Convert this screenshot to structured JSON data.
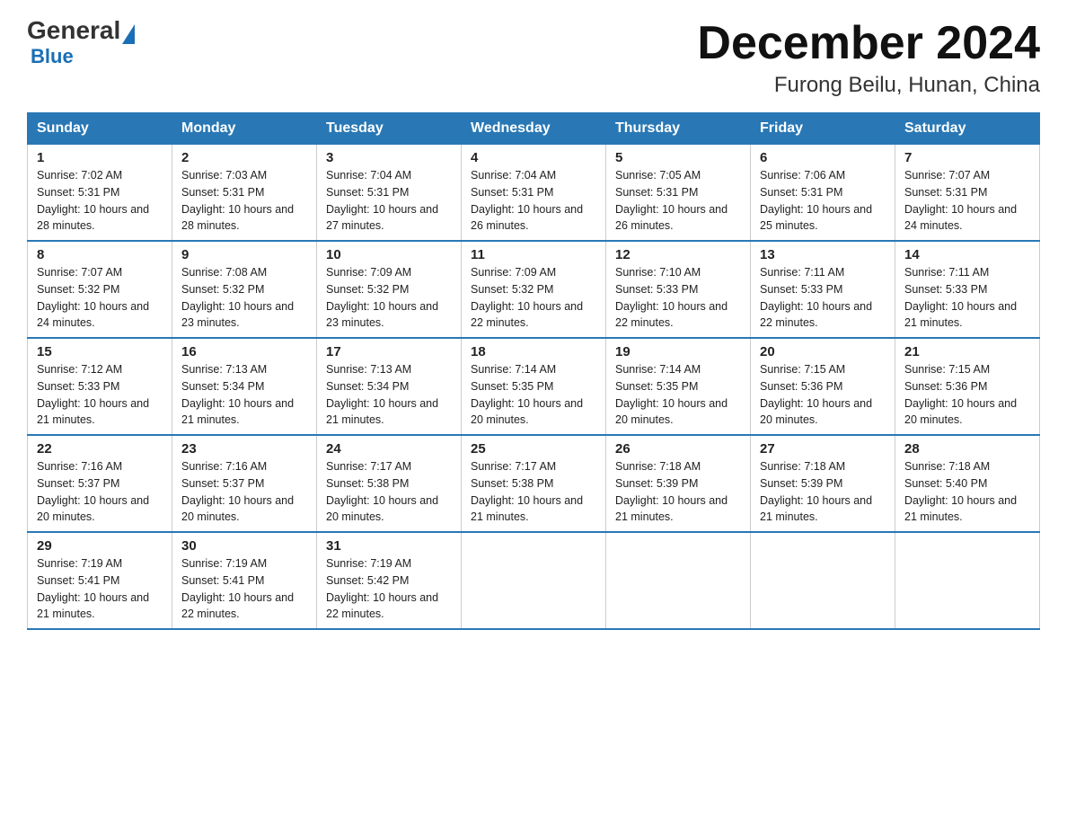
{
  "logo": {
    "general": "General",
    "blue": "Blue",
    "subtitle": "Blue"
  },
  "header": {
    "month_year": "December 2024",
    "location": "Furong Beilu, Hunan, China"
  },
  "weekdays": [
    "Sunday",
    "Monday",
    "Tuesday",
    "Wednesday",
    "Thursday",
    "Friday",
    "Saturday"
  ],
  "weeks": [
    [
      {
        "day": "1",
        "sunrise": "7:02 AM",
        "sunset": "5:31 PM",
        "daylight": "10 hours and 28 minutes."
      },
      {
        "day": "2",
        "sunrise": "7:03 AM",
        "sunset": "5:31 PM",
        "daylight": "10 hours and 28 minutes."
      },
      {
        "day": "3",
        "sunrise": "7:04 AM",
        "sunset": "5:31 PM",
        "daylight": "10 hours and 27 minutes."
      },
      {
        "day": "4",
        "sunrise": "7:04 AM",
        "sunset": "5:31 PM",
        "daylight": "10 hours and 26 minutes."
      },
      {
        "day": "5",
        "sunrise": "7:05 AM",
        "sunset": "5:31 PM",
        "daylight": "10 hours and 26 minutes."
      },
      {
        "day": "6",
        "sunrise": "7:06 AM",
        "sunset": "5:31 PM",
        "daylight": "10 hours and 25 minutes."
      },
      {
        "day": "7",
        "sunrise": "7:07 AM",
        "sunset": "5:31 PM",
        "daylight": "10 hours and 24 minutes."
      }
    ],
    [
      {
        "day": "8",
        "sunrise": "7:07 AM",
        "sunset": "5:32 PM",
        "daylight": "10 hours and 24 minutes."
      },
      {
        "day": "9",
        "sunrise": "7:08 AM",
        "sunset": "5:32 PM",
        "daylight": "10 hours and 23 minutes."
      },
      {
        "day": "10",
        "sunrise": "7:09 AM",
        "sunset": "5:32 PM",
        "daylight": "10 hours and 23 minutes."
      },
      {
        "day": "11",
        "sunrise": "7:09 AM",
        "sunset": "5:32 PM",
        "daylight": "10 hours and 22 minutes."
      },
      {
        "day": "12",
        "sunrise": "7:10 AM",
        "sunset": "5:33 PM",
        "daylight": "10 hours and 22 minutes."
      },
      {
        "day": "13",
        "sunrise": "7:11 AM",
        "sunset": "5:33 PM",
        "daylight": "10 hours and 22 minutes."
      },
      {
        "day": "14",
        "sunrise": "7:11 AM",
        "sunset": "5:33 PM",
        "daylight": "10 hours and 21 minutes."
      }
    ],
    [
      {
        "day": "15",
        "sunrise": "7:12 AM",
        "sunset": "5:33 PM",
        "daylight": "10 hours and 21 minutes."
      },
      {
        "day": "16",
        "sunrise": "7:13 AM",
        "sunset": "5:34 PM",
        "daylight": "10 hours and 21 minutes."
      },
      {
        "day": "17",
        "sunrise": "7:13 AM",
        "sunset": "5:34 PM",
        "daylight": "10 hours and 21 minutes."
      },
      {
        "day": "18",
        "sunrise": "7:14 AM",
        "sunset": "5:35 PM",
        "daylight": "10 hours and 20 minutes."
      },
      {
        "day": "19",
        "sunrise": "7:14 AM",
        "sunset": "5:35 PM",
        "daylight": "10 hours and 20 minutes."
      },
      {
        "day": "20",
        "sunrise": "7:15 AM",
        "sunset": "5:36 PM",
        "daylight": "10 hours and 20 minutes."
      },
      {
        "day": "21",
        "sunrise": "7:15 AM",
        "sunset": "5:36 PM",
        "daylight": "10 hours and 20 minutes."
      }
    ],
    [
      {
        "day": "22",
        "sunrise": "7:16 AM",
        "sunset": "5:37 PM",
        "daylight": "10 hours and 20 minutes."
      },
      {
        "day": "23",
        "sunrise": "7:16 AM",
        "sunset": "5:37 PM",
        "daylight": "10 hours and 20 minutes."
      },
      {
        "day": "24",
        "sunrise": "7:17 AM",
        "sunset": "5:38 PM",
        "daylight": "10 hours and 20 minutes."
      },
      {
        "day": "25",
        "sunrise": "7:17 AM",
        "sunset": "5:38 PM",
        "daylight": "10 hours and 21 minutes."
      },
      {
        "day": "26",
        "sunrise": "7:18 AM",
        "sunset": "5:39 PM",
        "daylight": "10 hours and 21 minutes."
      },
      {
        "day": "27",
        "sunrise": "7:18 AM",
        "sunset": "5:39 PM",
        "daylight": "10 hours and 21 minutes."
      },
      {
        "day": "28",
        "sunrise": "7:18 AM",
        "sunset": "5:40 PM",
        "daylight": "10 hours and 21 minutes."
      }
    ],
    [
      {
        "day": "29",
        "sunrise": "7:19 AM",
        "sunset": "5:41 PM",
        "daylight": "10 hours and 21 minutes."
      },
      {
        "day": "30",
        "sunrise": "7:19 AM",
        "sunset": "5:41 PM",
        "daylight": "10 hours and 22 minutes."
      },
      {
        "day": "31",
        "sunrise": "7:19 AM",
        "sunset": "5:42 PM",
        "daylight": "10 hours and 22 minutes."
      },
      null,
      null,
      null,
      null
    ]
  ]
}
